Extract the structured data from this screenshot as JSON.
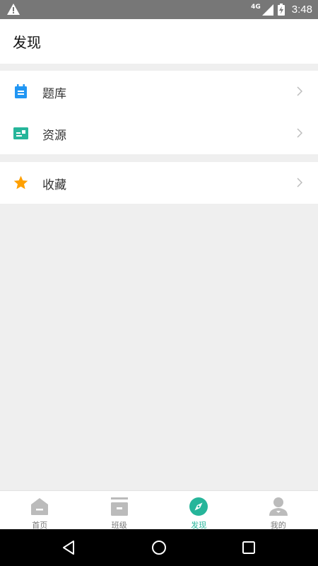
{
  "status_bar": {
    "network": "4G",
    "time": "3:48",
    "icons": [
      "warning-icon",
      "signal-icon",
      "battery-charging-icon"
    ]
  },
  "header": {
    "title": "发现"
  },
  "groups": [
    {
      "items": [
        {
          "label": "题库",
          "icon": "calendar-list-icon",
          "icon_color": "#2196f3"
        },
        {
          "label": "资源",
          "icon": "resource-card-icon",
          "icon_color": "#26b59a"
        }
      ]
    },
    {
      "items": [
        {
          "label": "收藏",
          "icon": "star-icon",
          "icon_color": "#ffa000"
        }
      ]
    }
  ],
  "bottom_nav": {
    "items": [
      {
        "label": "首页",
        "icon": "home-icon",
        "active": false
      },
      {
        "label": "班级",
        "icon": "class-icon",
        "active": false
      },
      {
        "label": "发现",
        "icon": "compass-icon",
        "active": true
      },
      {
        "label": "我的",
        "icon": "profile-icon",
        "active": false
      }
    ]
  },
  "colors": {
    "accent": "#26b59a",
    "inactive_icon": "#bbbbbb",
    "status_bar": "#777777",
    "background": "#efefef"
  },
  "system_nav": {
    "buttons": [
      "back-icon",
      "home-circle-icon",
      "recents-icon"
    ]
  }
}
